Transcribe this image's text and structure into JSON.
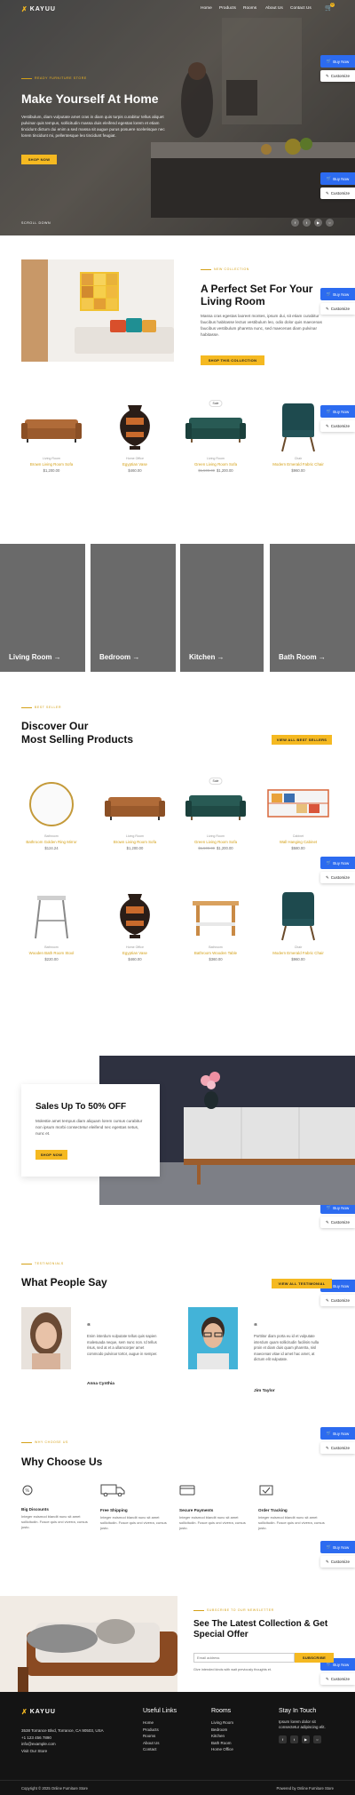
{
  "brand": {
    "name": "KAYUU",
    "accent": "#f5b921",
    "blue": "#2c6bf0"
  },
  "nav": {
    "items": [
      "Home",
      "Products",
      "Rooms",
      "About Us",
      "Contact Us"
    ],
    "cart_count": "0"
  },
  "hero": {
    "eyebrow": "Ready Furniture Store",
    "title": "Make Yourself At Home",
    "text": "Vestibulum, diam vulputate amet cras in diam quis turpis curabitur tellus aliquet pulvinar quis tempus, sollicitudin massa duis eleifend egestas lorem et etiam tincidunt dictum dui enim a sed massa sit augue purus posuere scelerisque nec lorem tincidunt mi, pellentesque leo tincidunt feugiat.",
    "button": "Shop Now",
    "scroll": "Scroll Down"
  },
  "floating": {
    "buy": "Buy Now",
    "customize": "Customize"
  },
  "set": {
    "eyebrow": "New Collection",
    "title": "A Perfect Set For Your Living Room",
    "text": "Massa cras egestas laoreet montes, ipsum dui, sit etiam curabitur faucibus habitasse lectus vestibulum leo, odio dolor quis maecenas faucibus vestibulum pharetra nunc, sed maecenas diam pulvinar habitasse.",
    "button": "Shop This Collection"
  },
  "products1": [
    {
      "cat": "Living Room",
      "name": "Brown Living Room Sofa",
      "price": "$1,200.00",
      "old": "",
      "sale": false
    },
    {
      "cat": "Home Office",
      "name": "Egyptian Vase",
      "price": "$460.00",
      "old": "",
      "sale": false
    },
    {
      "cat": "Living Room",
      "name": "Green Living Room Sofa",
      "price": "$1,200.00",
      "old": "$1,500.00",
      "sale": true
    },
    {
      "cat": "Chair",
      "name": "Modern Emerald Fabric Chair",
      "price": "$960.00",
      "old": "",
      "sale": false
    }
  ],
  "sale_label": "Sale",
  "rooms": [
    "Living Room →",
    "Bedroom →",
    "Kitchen →",
    "Bath Room →"
  ],
  "best": {
    "eyebrow": "Best Seller",
    "title_line1": "Discover Our",
    "title_line2": "Most Selling Products",
    "button": "View All Best Sellers"
  },
  "products2": [
    {
      "cat": "Bathroom",
      "name": "Bathroom Golden Ring Mirror",
      "price": "$124.24",
      "old": "",
      "sale": false
    },
    {
      "cat": "Living Room",
      "name": "Brown Living Room Sofa",
      "price": "$1,200.00",
      "old": "",
      "sale": false
    },
    {
      "cat": "Living Room",
      "name": "Green Living Room Sofa",
      "price": "$1,200.00",
      "old": "$1,500.00",
      "sale": true
    },
    {
      "cat": "Cabinet",
      "name": "Wall Hanging Cabinet",
      "price": "$580.00",
      "old": "",
      "sale": false
    },
    {
      "cat": "Bathroom",
      "name": "Wooden Bath Room Stool",
      "price": "$220.00",
      "old": "",
      "sale": false
    },
    {
      "cat": "Home Office",
      "name": "Egyptian Vase",
      "price": "$460.00",
      "old": "",
      "sale": false
    },
    {
      "cat": "Bathroom",
      "name": "Bathroom Wooden Table",
      "price": "$360.00",
      "old": "",
      "sale": false
    },
    {
      "cat": "Chair",
      "name": "Modern Emerald Fabric Chair",
      "price": "$960.00",
      "old": "",
      "sale": false
    }
  ],
  "promo": {
    "title": "Sales Up To 50% OFF",
    "text": "Molestie amet tempus diam aliquam lorem cursus curabitur non ipsum morbi consectetur eleifend nec egestas netus, nunc et.",
    "button": "Shop Now"
  },
  "testimonials": {
    "eyebrow": "Testimonials",
    "title": "What People Say",
    "button": "View All Testimonial",
    "items": [
      {
        "quote": "Enim interdum vulputate tellus quis sapien malesuada neque, sem nunc non. Id tellus risus, sed at et a ullamcorper amet commodo pulvinar tortor, augue in semper.",
        "name": "Anna Cynthia"
      },
      {
        "quote": "Porttitor diam porta eu id et vulputate interdum quam sollicitudin facilisis nulla proin et diam duis quam pharetra, nisl maecenas vitae id amet hac amet, at dictum elit vulputate.",
        "name": "Jim Taylor"
      }
    ]
  },
  "why": {
    "eyebrow": "Why Choose Us",
    "title": "Why Choose Us",
    "items": [
      {
        "title": "Big Discounts",
        "text": "Integer euismod blandit nunc sit amet sollicitudin. Fusce quis orci viverra, cursus justo."
      },
      {
        "title": "Free Shipping",
        "text": "Integer euismod blandit nunc sit amet sollicitudin. Fusce quis orci viverra, cursus justo."
      },
      {
        "title": "Secure Payments",
        "text": "Integer euismod blandit nunc sit amet sollicitudin. Fusce quis orci viverra, cursus justo."
      },
      {
        "title": "Order Tracking",
        "text": "Integer euismod blandit nunc sit amet sollicitudin. Fusce quis orci viverra, cursus justo."
      }
    ]
  },
  "newsletter": {
    "eyebrow": "Subscribe To Our Newsletter",
    "title": "See The Latest Collection & Get Special Offer",
    "placeholder": "Email address",
    "button": "Subscribe",
    "note": "Give intended kinds with wait previously thoughts et."
  },
  "footer": {
    "address": [
      "3538 Torrance Blvd, Torrance, CA 90503, USA",
      "+1 123 456 7890",
      "info@example.com",
      "Visit Our Store"
    ],
    "useful_title": "Useful Links",
    "useful": [
      "Home",
      "Products",
      "Rooms",
      "About Us",
      "Contact"
    ],
    "rooms_title": "Rooms",
    "rooms": [
      "Living Room",
      "Bedroom",
      "Kitchen",
      "Bath Room",
      "Home Office"
    ],
    "touch_title": "Stay In Touch",
    "touch_text": "Ipsum lorem dolor sit consectetur adipiscing elit.",
    "copyright": "Copyright © 2025 Online Furniture Store",
    "powered": "Powered by Online Furniture Store"
  }
}
